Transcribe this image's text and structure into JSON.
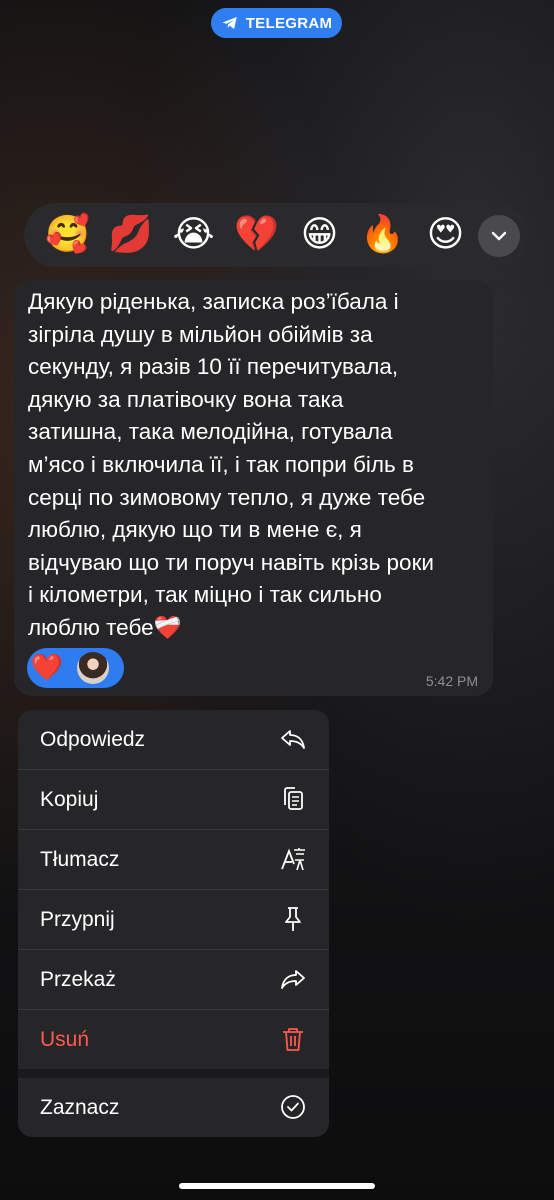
{
  "app_badge": {
    "label": "TELEGRAM"
  },
  "reactions": [
    {
      "icon": "smiling-face-with-hearts-icon",
      "glyph": "🥰"
    },
    {
      "icon": "kiss-mark-icon",
      "glyph": "💋"
    },
    {
      "icon": "loudly-crying-face-icon",
      "glyph": "😭"
    },
    {
      "icon": "broken-heart-icon",
      "glyph": "💔"
    },
    {
      "icon": "grinning-face-icon",
      "glyph": "😁"
    },
    {
      "icon": "fire-icon",
      "glyph": "🔥"
    },
    {
      "icon": "heart-eyes-icon",
      "glyph": "😍"
    }
  ],
  "message": {
    "text": "Дякую ріденька, записка роз’їбала і\nзігріла душу в мільйон обіймів за\nсекунду, я разів 10 її перечитувала,\nдякую за платівочку вона така\nзатишна, така мелодійна, готувала\nм’ясо і включила її, і так попри біль в\nсерці по зимовому тепло, я дуже тебе\nлюблю, дякую що ти в мене є, я\nвідчуваю що ти поруч навіть крізь роки\nі кілометри, так міцно і так сильно\nлюблю тебе❤️‍🩹",
    "reaction_glyph": "❤️",
    "time": "5:42 PM"
  },
  "menu": {
    "items": [
      {
        "label": "Odpowiedz",
        "icon": "reply-icon"
      },
      {
        "label": "Kopiuj",
        "icon": "copy-icon"
      },
      {
        "label": "Tłumacz",
        "icon": "translate-icon"
      },
      {
        "label": "Przypnij",
        "icon": "pin-icon"
      },
      {
        "label": "Przekaż",
        "icon": "forward-icon"
      },
      {
        "label": "Usuń",
        "icon": "trash-icon"
      }
    ],
    "select_label": "Zaznacz",
    "danger_color": "#ff5a4e"
  },
  "colors": {
    "accent": "#2f7ff0",
    "bubble": "#262628"
  }
}
